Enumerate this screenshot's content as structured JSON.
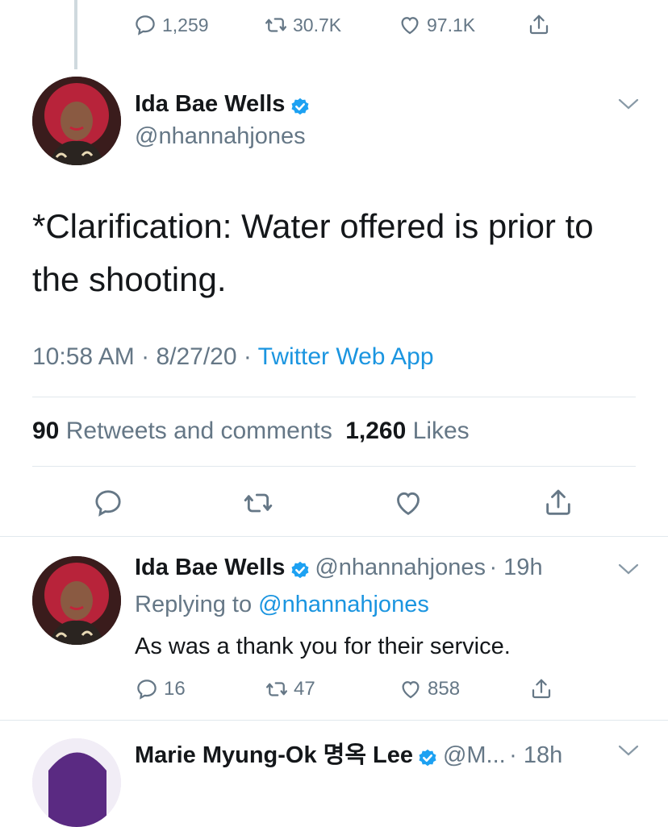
{
  "top_tweet": {
    "replies": "1,259",
    "retweets": "30.7K",
    "likes": "97.1K"
  },
  "main_tweet": {
    "author_name": "Ida Bae Wells",
    "author_handle": "@nhannahjones",
    "text": "*Clarification: Water offered is prior to the shooting.",
    "time": "10:58 AM",
    "sep1": " · ",
    "date": "8/27/20",
    "sep2": " · ",
    "source": "Twitter Web App",
    "retweet_count": "90",
    "retweet_label": "Retweets and comments",
    "like_count": "1,260",
    "like_label": "Likes"
  },
  "reply": {
    "author_name": "Ida Bae Wells",
    "author_handle": "@nhannahjones",
    "time": "· 19h",
    "replying_prefix": "Replying to ",
    "replying_handle": "@nhannahjones",
    "text": "As was a thank you for their service.",
    "replies": "16",
    "retweets": "47",
    "likes": "858"
  },
  "next_reply": {
    "author_name": "Marie Myung-Ok 명옥 Lee",
    "author_handle": "@M...",
    "time": "· 18h"
  },
  "colors": {
    "accent": "#1b95e0",
    "muted": "#657786",
    "verified": "#1da1f2"
  }
}
